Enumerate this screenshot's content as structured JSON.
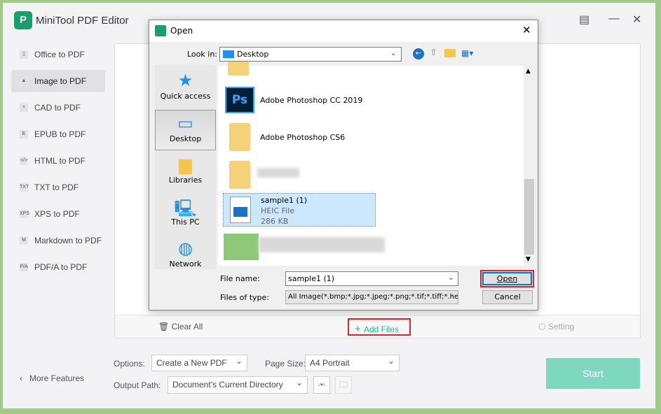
{
  "app": {
    "title": "MiniTool PDF Editor",
    "logo_letter": "P"
  },
  "sidebar": {
    "items": [
      {
        "label": "Office to PDF",
        "icon": "office-icon",
        "glyph": "▯"
      },
      {
        "label": "Image to PDF",
        "icon": "image-icon",
        "glyph": "▲",
        "active": true
      },
      {
        "label": "CAD to PDF",
        "icon": "cad-icon",
        "glyph": "+"
      },
      {
        "label": "EPUB to PDF",
        "icon": "epub-icon",
        "glyph": "E"
      },
      {
        "label": "HTML to PDF",
        "icon": "html-icon",
        "glyph": "</>"
      },
      {
        "label": "TXT to PDF",
        "icon": "txt-icon",
        "glyph": "TXT"
      },
      {
        "label": "XPS to PDF",
        "icon": "xps-icon",
        "glyph": "XPS"
      },
      {
        "label": "Markdown to PDF",
        "icon": "markdown-icon",
        "glyph": "M"
      },
      {
        "label": "PDF/A to PDF",
        "icon": "pdfa-icon",
        "glyph": "P/A"
      }
    ],
    "more_features": "More Features"
  },
  "toolbar": {
    "clear_all": "Clear All",
    "add_files": "Add Files",
    "setting": "Setting"
  },
  "options": {
    "options_label": "Options:",
    "options_value": "Create a New PDF",
    "page_size_label": "Page Size:",
    "page_size_value": "A4 Portrait",
    "output_label": "Output Path:",
    "output_value": "Document's Current Directory",
    "browse": "···",
    "start": "Start"
  },
  "dialog": {
    "title": "Open",
    "look_in_label": "Look in:",
    "look_in_value": "Desktop",
    "places": [
      "Quick access",
      "Desktop",
      "Libraries",
      "This PC",
      "Network"
    ],
    "files": [
      {
        "name": "Adobe Photoshop CC 2019"
      },
      {
        "name": "Adobe Photoshop CS6"
      }
    ],
    "selected": {
      "name": "sample1 (1)",
      "type": "HEIC File",
      "size": "286 KB"
    },
    "file_name_label": "File name:",
    "file_name_value": "sample1 (1)",
    "file_type_label": "Files of type:",
    "file_type_value": "All Image(*.bmp;*.jpg;*.jpeg;*.png;*.tif;*.tiff;*.heic",
    "open": "Open",
    "cancel": "Cancel"
  },
  "colors": {
    "accent": "#1a9e6e",
    "add_files": "#1ec08f",
    "highlight": "#e8202a",
    "start": "#7ed8bf"
  }
}
